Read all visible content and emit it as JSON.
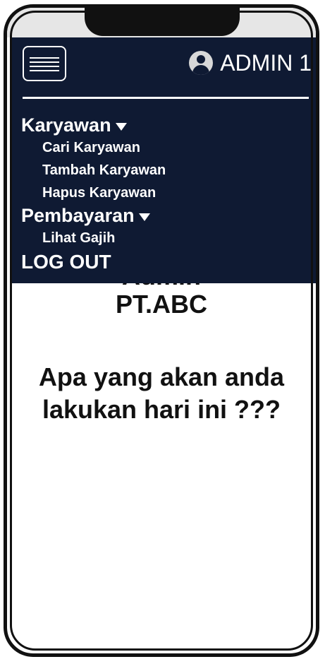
{
  "header": {
    "admin_label": "ADMIN 1"
  },
  "menu": {
    "sections": [
      {
        "label": "Karyawan",
        "items": [
          "Cari Karyawan",
          "Tambah Karyawan",
          "Hapus Karyawan"
        ]
      },
      {
        "label": "Pembayaran",
        "items": [
          "Lihat Gajih"
        ]
      }
    ],
    "logout_label": "LOG OUT"
  },
  "main": {
    "greeting": "Admin",
    "company": "PT.ABC",
    "question": "Apa yang akan anda lakukan hari ini ???"
  },
  "colors": {
    "menu_bg": "#0f1a33",
    "menu_text": "#ffffff",
    "body_text": "#111111"
  },
  "icons": {
    "menu": "hamburger-icon",
    "user": "user-avatar-icon",
    "dropdown": "caret-down-icon"
  }
}
